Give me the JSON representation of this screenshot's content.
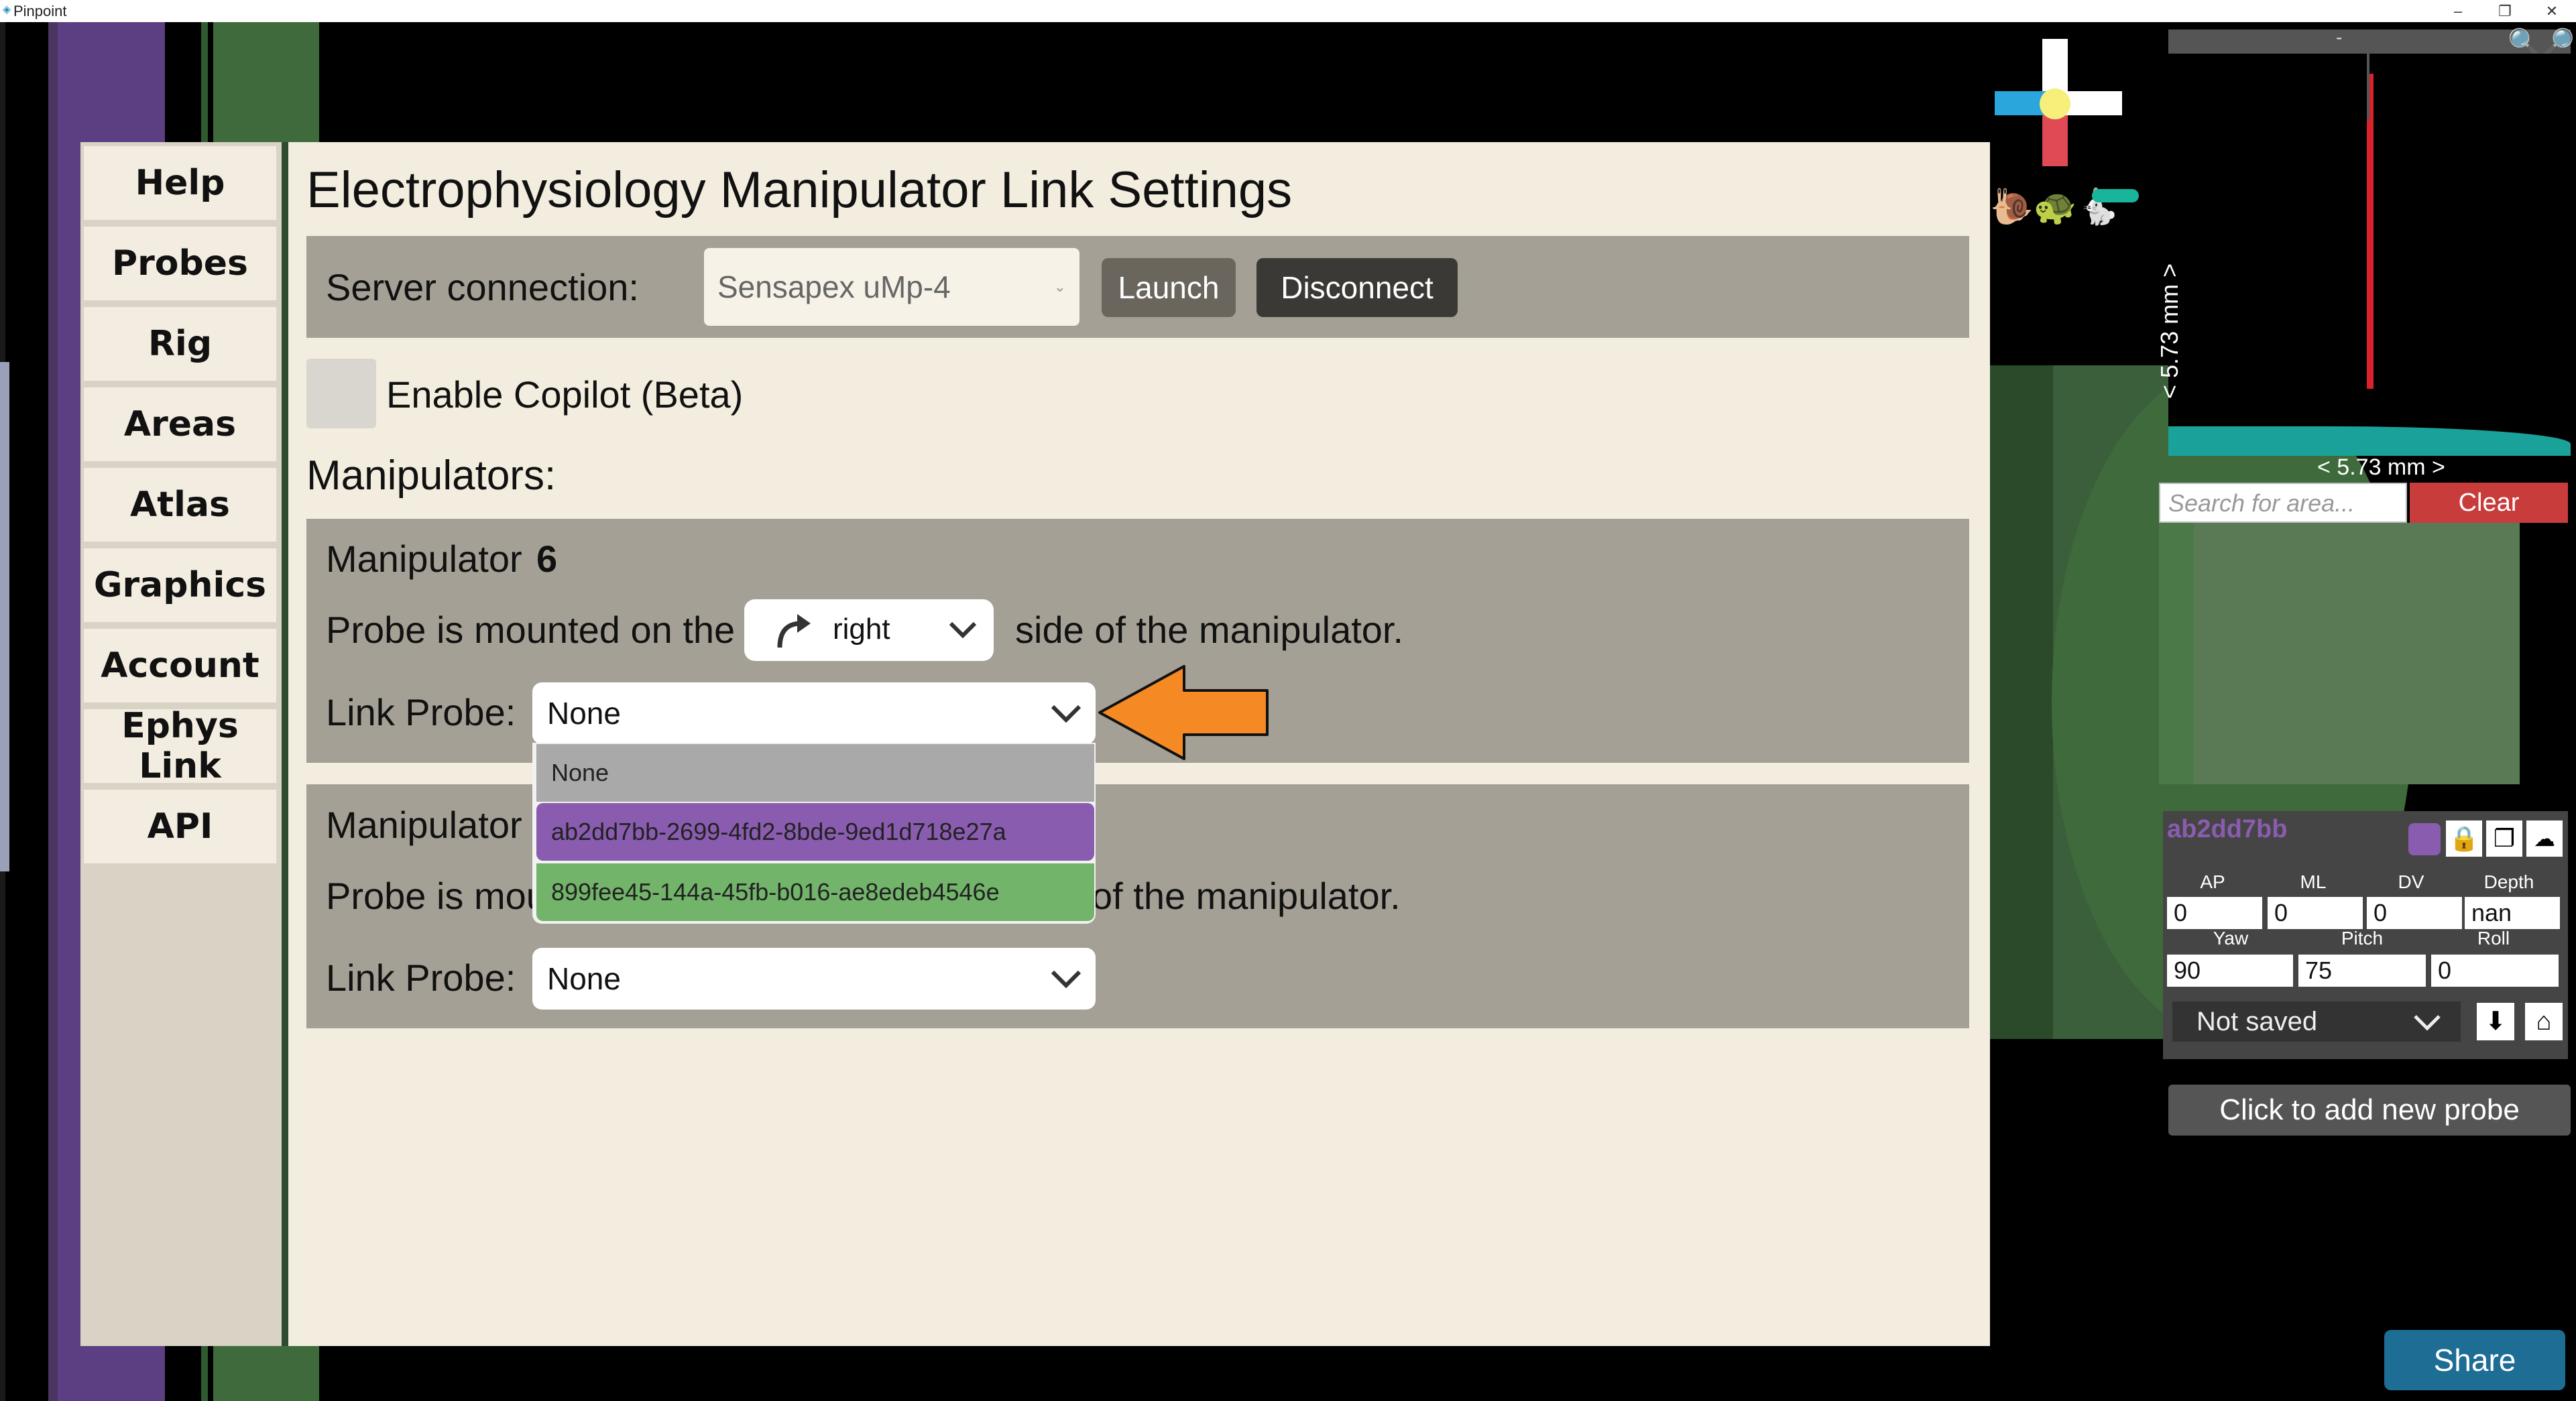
{
  "window": {
    "title": "Pinpoint",
    "minimize": "–",
    "restore": "❐",
    "close": "✕"
  },
  "menu": {
    "items": [
      {
        "id": "help",
        "label": "Help"
      },
      {
        "id": "probes",
        "label": "Probes"
      },
      {
        "id": "rig",
        "label": "Rig"
      },
      {
        "id": "areas",
        "label": "Areas"
      },
      {
        "id": "atlas",
        "label": "Atlas"
      },
      {
        "id": "graphics",
        "label": "Graphics"
      },
      {
        "id": "account",
        "label": "Account"
      },
      {
        "id": "ephys",
        "label": "Ephys Link"
      },
      {
        "id": "api",
        "label": "API"
      }
    ]
  },
  "settings": {
    "title": "Electrophysiology Manipulator Link Settings",
    "server_label": "Server connection:",
    "server_value": "Sensapex uMp-4",
    "launch_label": "Launch",
    "disconnect_label": "Disconnect",
    "copilot_label": "Enable Copilot (Beta)",
    "manipulators_heading": "Manipulators:",
    "manipulator1": {
      "label": "Manipulator",
      "id": "6",
      "mount_prefix": "Probe is mounted on the",
      "mount_value": "right",
      "mount_suffix": "side of the manipulator.",
      "link_label": "Link Probe:",
      "link_value": "None"
    },
    "manipulator2": {
      "label": "Manipulator",
      "mount_prefix": "Probe is mou",
      "mount_suffix": "of the manipulator.",
      "link_label": "Link Probe:",
      "link_value": "None"
    },
    "link_options": [
      {
        "label": "None",
        "color": "#a9a9a9"
      },
      {
        "label": "ab2dd7bb-2699-4fd2-8bde-9ed1d718e27a",
        "color": "#8a5cb0"
      },
      {
        "label": "899fee45-144a-45fb-b016-ae8edeb4546e",
        "color": "#72b46a"
      }
    ]
  },
  "right_panel": {
    "scale_top": "-",
    "scale_vertical": "< 5.73 mm >",
    "scale_horizontal": "< 5.73 mm >",
    "search_placeholder": "Search for area...",
    "clear_label": "Clear",
    "probe_name": "ab2dd7bb",
    "probe_color": "#8a5cb0",
    "fields_row1_labels": [
      "AP",
      "ML",
      "DV",
      "Depth"
    ],
    "fields_row1_values": [
      "0",
      "0",
      "0",
      "nan"
    ],
    "fields_row2_labels": [
      "Yaw",
      "Pitch",
      "Roll"
    ],
    "fields_row2_values": [
      "90",
      "75",
      "0"
    ],
    "save_state": "Not saved",
    "add_probe_label": "Click to add new probe",
    "share_label": "Share"
  },
  "colors": {
    "panel_bg": "#f3eddf",
    "band": "#a5a095",
    "arrow": "#f58a25",
    "share": "#1e6d95"
  }
}
